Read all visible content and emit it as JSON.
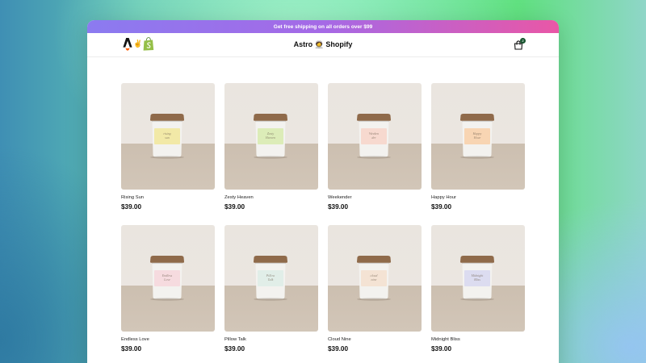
{
  "announcement": "Get free shipping on all orders over $99",
  "header": {
    "brand": "Astro 🧑‍🚀 Shopify",
    "cart_count": "2"
  },
  "products": [
    {
      "name": "Rising Sun",
      "price": "$39.00",
      "label_color": "#f2e9a7",
      "label_text": "rising sun"
    },
    {
      "name": "Zesty Heaven",
      "price": "$39.00",
      "label_color": "#dcecb8",
      "label_text": "Zesty Heaven"
    },
    {
      "name": "Weekender",
      "price": "$39.00",
      "label_color": "#f7d9cf",
      "label_text": "Weeken der"
    },
    {
      "name": "Happy Hour",
      "price": "$39.00",
      "label_color": "#f8d5b3",
      "label_text": "Happy Hour"
    },
    {
      "name": "Endless Love",
      "price": "$39.00",
      "label_color": "#f6dbdf",
      "label_text": "Endless Love"
    },
    {
      "name": "Pillow Talk",
      "price": "$39.00",
      "label_color": "#e1eee8",
      "label_text": "Pillow Talk"
    },
    {
      "name": "Cloud Nine",
      "price": "$39.00",
      "label_color": "#f4e3d4",
      "label_text": "cloud nine"
    },
    {
      "name": "Midnight Bliss",
      "price": "$39.00",
      "label_color": "#dcdcf0",
      "label_text": "Midnight Bliss"
    }
  ]
}
